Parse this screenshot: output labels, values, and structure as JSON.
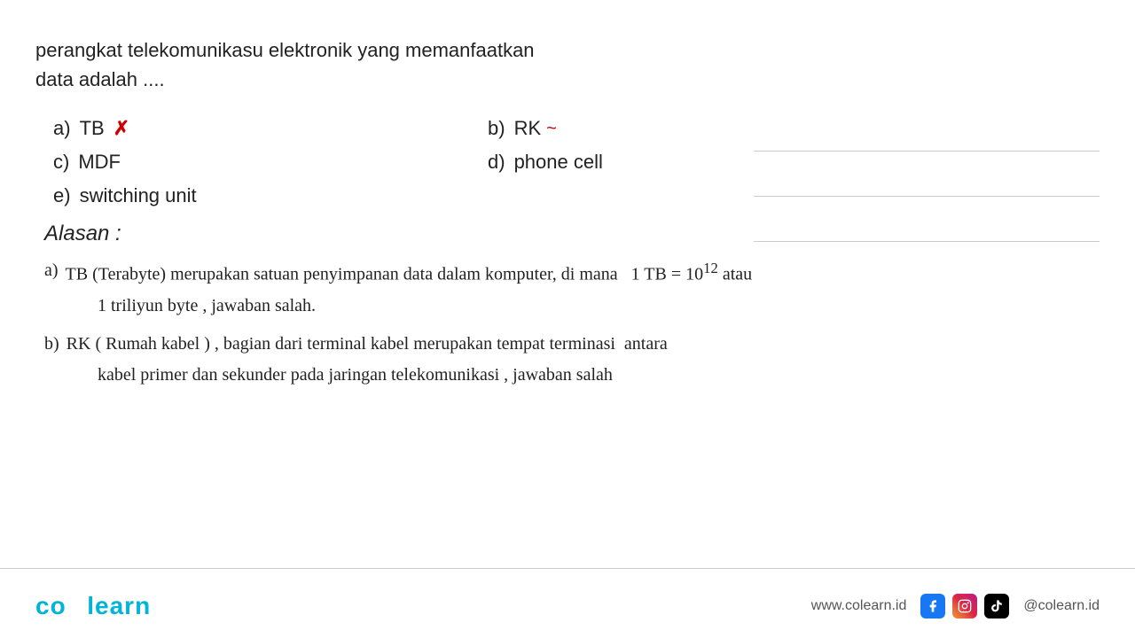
{
  "question": {
    "text_line1": "perangkat telekomunikasu elektronik yang memanfaatkan",
    "text_line2": "data adalah ...."
  },
  "options": {
    "a": {
      "label": "a)",
      "value": "TB",
      "mark": "✗",
      "mark_type": "cross"
    },
    "b": {
      "label": "b)",
      "value": "RK",
      "mark": "~",
      "mark_type": "tilde"
    },
    "c": {
      "label": "c)",
      "value": "MDF",
      "mark": "",
      "mark_type": ""
    },
    "d": {
      "label": "d)",
      "value": "phone cell",
      "mark": "",
      "mark_type": ""
    },
    "e": {
      "label": "e)",
      "value": "switching unit",
      "mark": "",
      "mark_type": ""
    }
  },
  "alasan": {
    "title": "Alasan :",
    "items": [
      {
        "label": "a)",
        "text_main": "TB (Terabyte) merupakan satuan penyimpanan data dalam komputer, di mana  1 TB = 10¹² atau",
        "text_sub": "1 triliyun byte , jawaban salah."
      },
      {
        "label": "b)",
        "text_main": "RK ( Rumah kabel ) , bagian dari terminal kabel merupakan tempat terminasi  antara",
        "text_sub": "kabel primer dan sekunder pada jaringan telekomunikasi , jawaban salah"
      }
    ]
  },
  "footer": {
    "brand": "co learn",
    "website": "www.colearn.id",
    "social_handle": "@colearn.id"
  },
  "colors": {
    "brand": "#00b4d8",
    "cross": "#cc0000",
    "divider": "#cccccc",
    "text": "#222222"
  }
}
